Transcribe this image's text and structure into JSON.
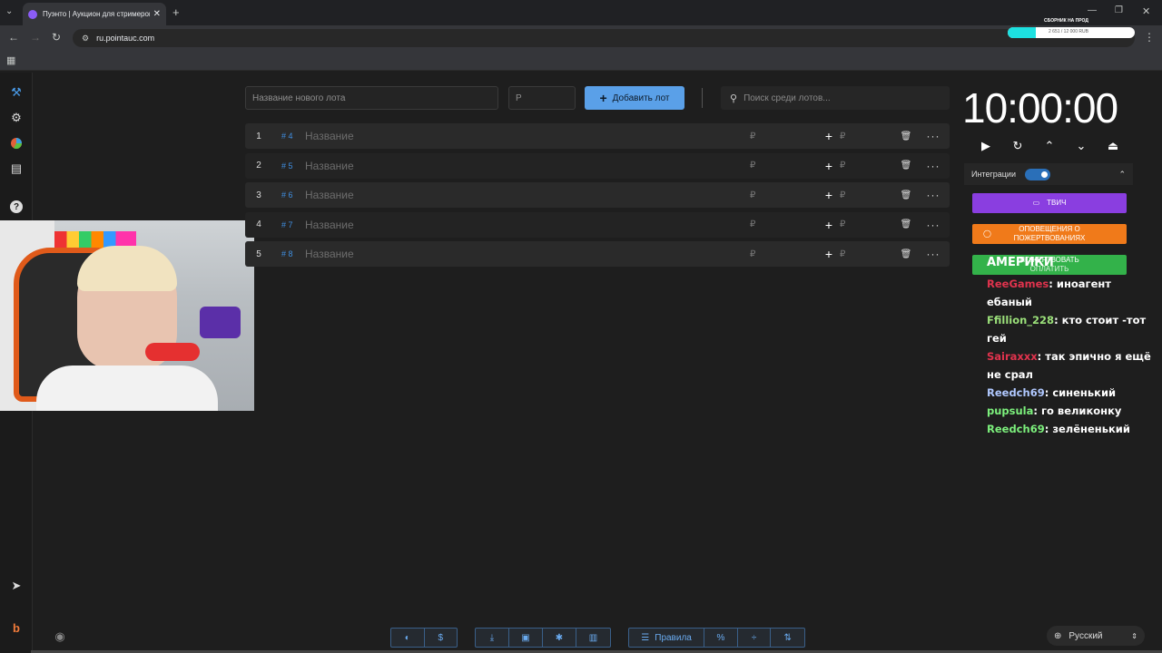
{
  "browser": {
    "tab_title": "Пуэнто | Аукцион для стримеров",
    "url": "ru.pointauc.com"
  },
  "donation_widget": {
    "title": "СБОРНИК НА ПРОД",
    "progress_text": "2 651 / 12 000 RUB",
    "progress": 0.22
  },
  "toolbar": {
    "new_lot_placeholder": "Название нового лота",
    "amount_placeholder": "Р",
    "add_label": "Добавить лот",
    "search_placeholder": "Поиск среди лотов..."
  },
  "lots": [
    {
      "num": "1",
      "id": "# 4",
      "name": "Название",
      "currency": "₽"
    },
    {
      "num": "2",
      "id": "# 5",
      "name": "Название",
      "currency": "₽"
    },
    {
      "num": "3",
      "id": "# 6",
      "name": "Название",
      "currency": "₽"
    },
    {
      "num": "4",
      "id": "# 7",
      "name": "Название",
      "currency": "₽"
    },
    {
      "num": "5",
      "id": "# 8",
      "name": "Название",
      "currency": "₽"
    }
  ],
  "timer": {
    "value": "10:00:00"
  },
  "integrations": {
    "label": "Интеграции",
    "twitch_label": "ТВИЧ",
    "donations_label": "ОПОВЕЩЕНИЯ О ПОЖЕРТВОВАНИЯХ",
    "donate_label": "ПОЖЕРТВОВАТЬ",
    "pay_label": "ОПЛАТИТЬ",
    "overlay_text": "АМЕРИКИ"
  },
  "chat": [
    {
      "user": "ReeGames",
      "color": "#e0334d",
      "msg": "иноагент ебаный"
    },
    {
      "user": "Ffillion_228",
      "color": "#9be07a",
      "msg": "кто стоит -тот гей"
    },
    {
      "user": "Sairaxxx",
      "color": "#e0334d",
      "msg": "так эпично я ещё не срал"
    },
    {
      "user": "Reedch69",
      "color": "#b0c8ff",
      "msg": "синенький"
    },
    {
      "user": "pupsula",
      "color": "#7cf07c",
      "msg": "го великонку"
    },
    {
      "user": "Reedch69",
      "color": "#7cf07c",
      "msg": "зелёненький"
    }
  ],
  "footer": {
    "rules_label": "Правила",
    "percent_label": "%",
    "language": "Русский"
  },
  "colors": {
    "accent": "#5aa0e8",
    "twitch": "#8a3ee0",
    "donations": "#f07a1a",
    "donate": "#33b24a"
  }
}
